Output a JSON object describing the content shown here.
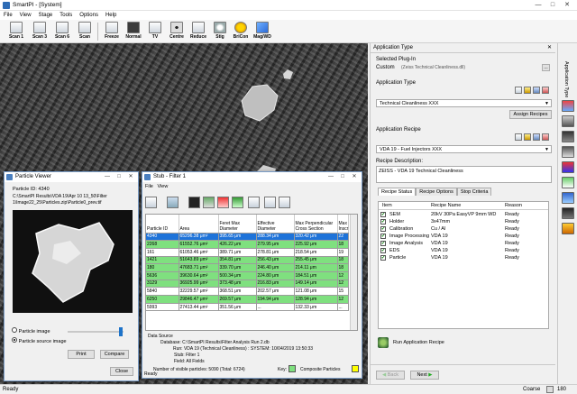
{
  "app": {
    "title": "SmartPI - [System]"
  },
  "menu": [
    "File",
    "View",
    "Stage",
    "Tools",
    "Options",
    "Help"
  ],
  "toolbar": [
    "Scan 1",
    "Scan 3",
    "Scan 6",
    "Scan",
    "Freeze",
    "Normal",
    "TV",
    "Centre",
    "Reduce",
    "Stig",
    "BriCon",
    "Mag/WD"
  ],
  "particle_viewer": {
    "title": "Particle Viewer",
    "particle_id": "Particle ID: 4340",
    "path_line1": "C:\\SmartPI Results\\VDA 19\\Apr 10 13_50\\Filter",
    "path_line2": "1\\Image22_25\\Particles.zip\\Particle0_prev.tif",
    "radio_particle_image": "Particle image",
    "radio_source_image": "Particle source image",
    "print_label": "Print",
    "compare_label": "Compare",
    "close_label": "Close"
  },
  "stub": {
    "title": "Stub - Filter 1",
    "menu": [
      "File",
      "View"
    ],
    "columns": [
      "Particle ID",
      "Area",
      "Feret Max Diameter",
      "Effective Diameter",
      "Max Perpendicular Cross Section",
      "Max Inscr"
    ],
    "rows": [
      {
        "id": "4340",
        "area": "65296.38 μm²",
        "feret": "395.65 μm",
        "eff": "288.34 μm",
        "perp": "320.42 μm",
        "ins": "22",
        "style": "sel"
      },
      {
        "id": "2268",
        "area": "61552.76 μm²",
        "feret": "426.22 μm",
        "eff": "279.95 μm",
        "perp": "225.92 μm",
        "ins": "18",
        "style": "g"
      },
      {
        "id": "161",
        "area": "61053.46 μm²",
        "feret": "389.71 μm",
        "eff": "278.81 μm",
        "perp": "218.54 μm",
        "ins": "19",
        "style": "w"
      },
      {
        "id": "1421",
        "area": "51643.89 μm²",
        "feret": "354.81 μm",
        "eff": "256.43 μm",
        "perp": "255.45 μm",
        "ins": "18",
        "style": "g"
      },
      {
        "id": "180",
        "area": "47683.71 μm²",
        "feret": "339.70 μm",
        "eff": "246.40 μm",
        "perp": "214.11 μm",
        "ins": "18",
        "style": "g"
      },
      {
        "id": "5636",
        "area": "39630.64 μm²",
        "feret": "500.34 μm",
        "eff": "224.80 μm",
        "perp": "184.51 μm",
        "ins": "12",
        "style": "g"
      },
      {
        "id": "3129",
        "area": "36925.99 μm²",
        "feret": "373.48 μm",
        "eff": "216.83 μm",
        "perp": "149.14 μm",
        "ins": "12",
        "style": "g"
      },
      {
        "id": "5840",
        "area": "32229.57 μm²",
        "feret": "368.51 μm",
        "eff": "202.57 μm",
        "perp": "121.08 μm",
        "ins": "15",
        "style": "w"
      },
      {
        "id": "6250",
        "area": "29846.47 μm²",
        "feret": "269.57 μm",
        "eff": "194.94 μm",
        "perp": "128.94 μm",
        "ins": "12",
        "style": "g"
      },
      {
        "id": "5993",
        "area": "27413.44 μm²",
        "feret": "351.56 μm",
        "eff": "...",
        "perp": "132.33 μm",
        "ins": "...",
        "style": "w"
      }
    ],
    "data_source_label": "Data Source",
    "database": "Database:  C:\\SmartPI Results\\Filter Analysis Run 2.db",
    "run": "Run:  VDA 19 (Technical Cleanliness) : SYSTEM: 10/04/2019 13:50:33",
    "stub_line": "Stub:  Filter 1",
    "field": "Field:  All Fields",
    "visible_count": "Number of visible particles:     5090 (Total: 6724)",
    "key_label": "Key:",
    "composite_label": "Composite Particles",
    "status": "Ready"
  },
  "right_panel": {
    "header": "Application Type",
    "plugin_label": "Selected Plug-In",
    "plugin_value": "Custom",
    "plugin_file": "(Zeiss Technical Cleanliness.dll)",
    "app_type_label": "Application Type",
    "app_type_value": "Technical Cleanliness XXX",
    "assign_label": "Assign Recipes",
    "app_recipe_label": "Application Recipe",
    "recipe_value": "VDA 19 - Fuel Injectors XXX",
    "desc_label": "Recipe Description:",
    "desc_value": "ZEISS - VDA 19 Technical Cleanliness",
    "tabs": [
      "Recipe Status",
      "Recipe Options",
      "Stop Criteria"
    ],
    "list_headers": [
      "Item",
      "Recipe Name",
      "Reason"
    ],
    "items": [
      {
        "item": "SEM",
        "recipe": "20kV 30Pa EasyVP 9mm WD",
        "reason": "Ready"
      },
      {
        "item": "Holder",
        "recipe": "3x47mm",
        "reason": "Ready"
      },
      {
        "item": "Calibration",
        "recipe": "Cu / Al",
        "reason": "Ready"
      },
      {
        "item": "Image Processing",
        "recipe": "VDA 19",
        "reason": "Ready"
      },
      {
        "item": "Image Analysis",
        "recipe": "VDA 19",
        "reason": "Ready"
      },
      {
        "item": "EDS",
        "recipe": "VDA 19",
        "reason": "Ready"
      },
      {
        "item": "Particle",
        "recipe": "VDA 19",
        "reason": "Ready"
      }
    ],
    "run_label": "Run Application Recipe",
    "back_label": "Back",
    "next_label": "Next",
    "side_label": "Application Type"
  },
  "statusbar": {
    "left": "Ready",
    "coarse": "Coarse",
    "value": "180"
  },
  "colors": {
    "accent": "#1e73d9",
    "green_row": "#7fe07f",
    "key_green": "#7fe07f",
    "key_yellow": "#ffff00"
  }
}
